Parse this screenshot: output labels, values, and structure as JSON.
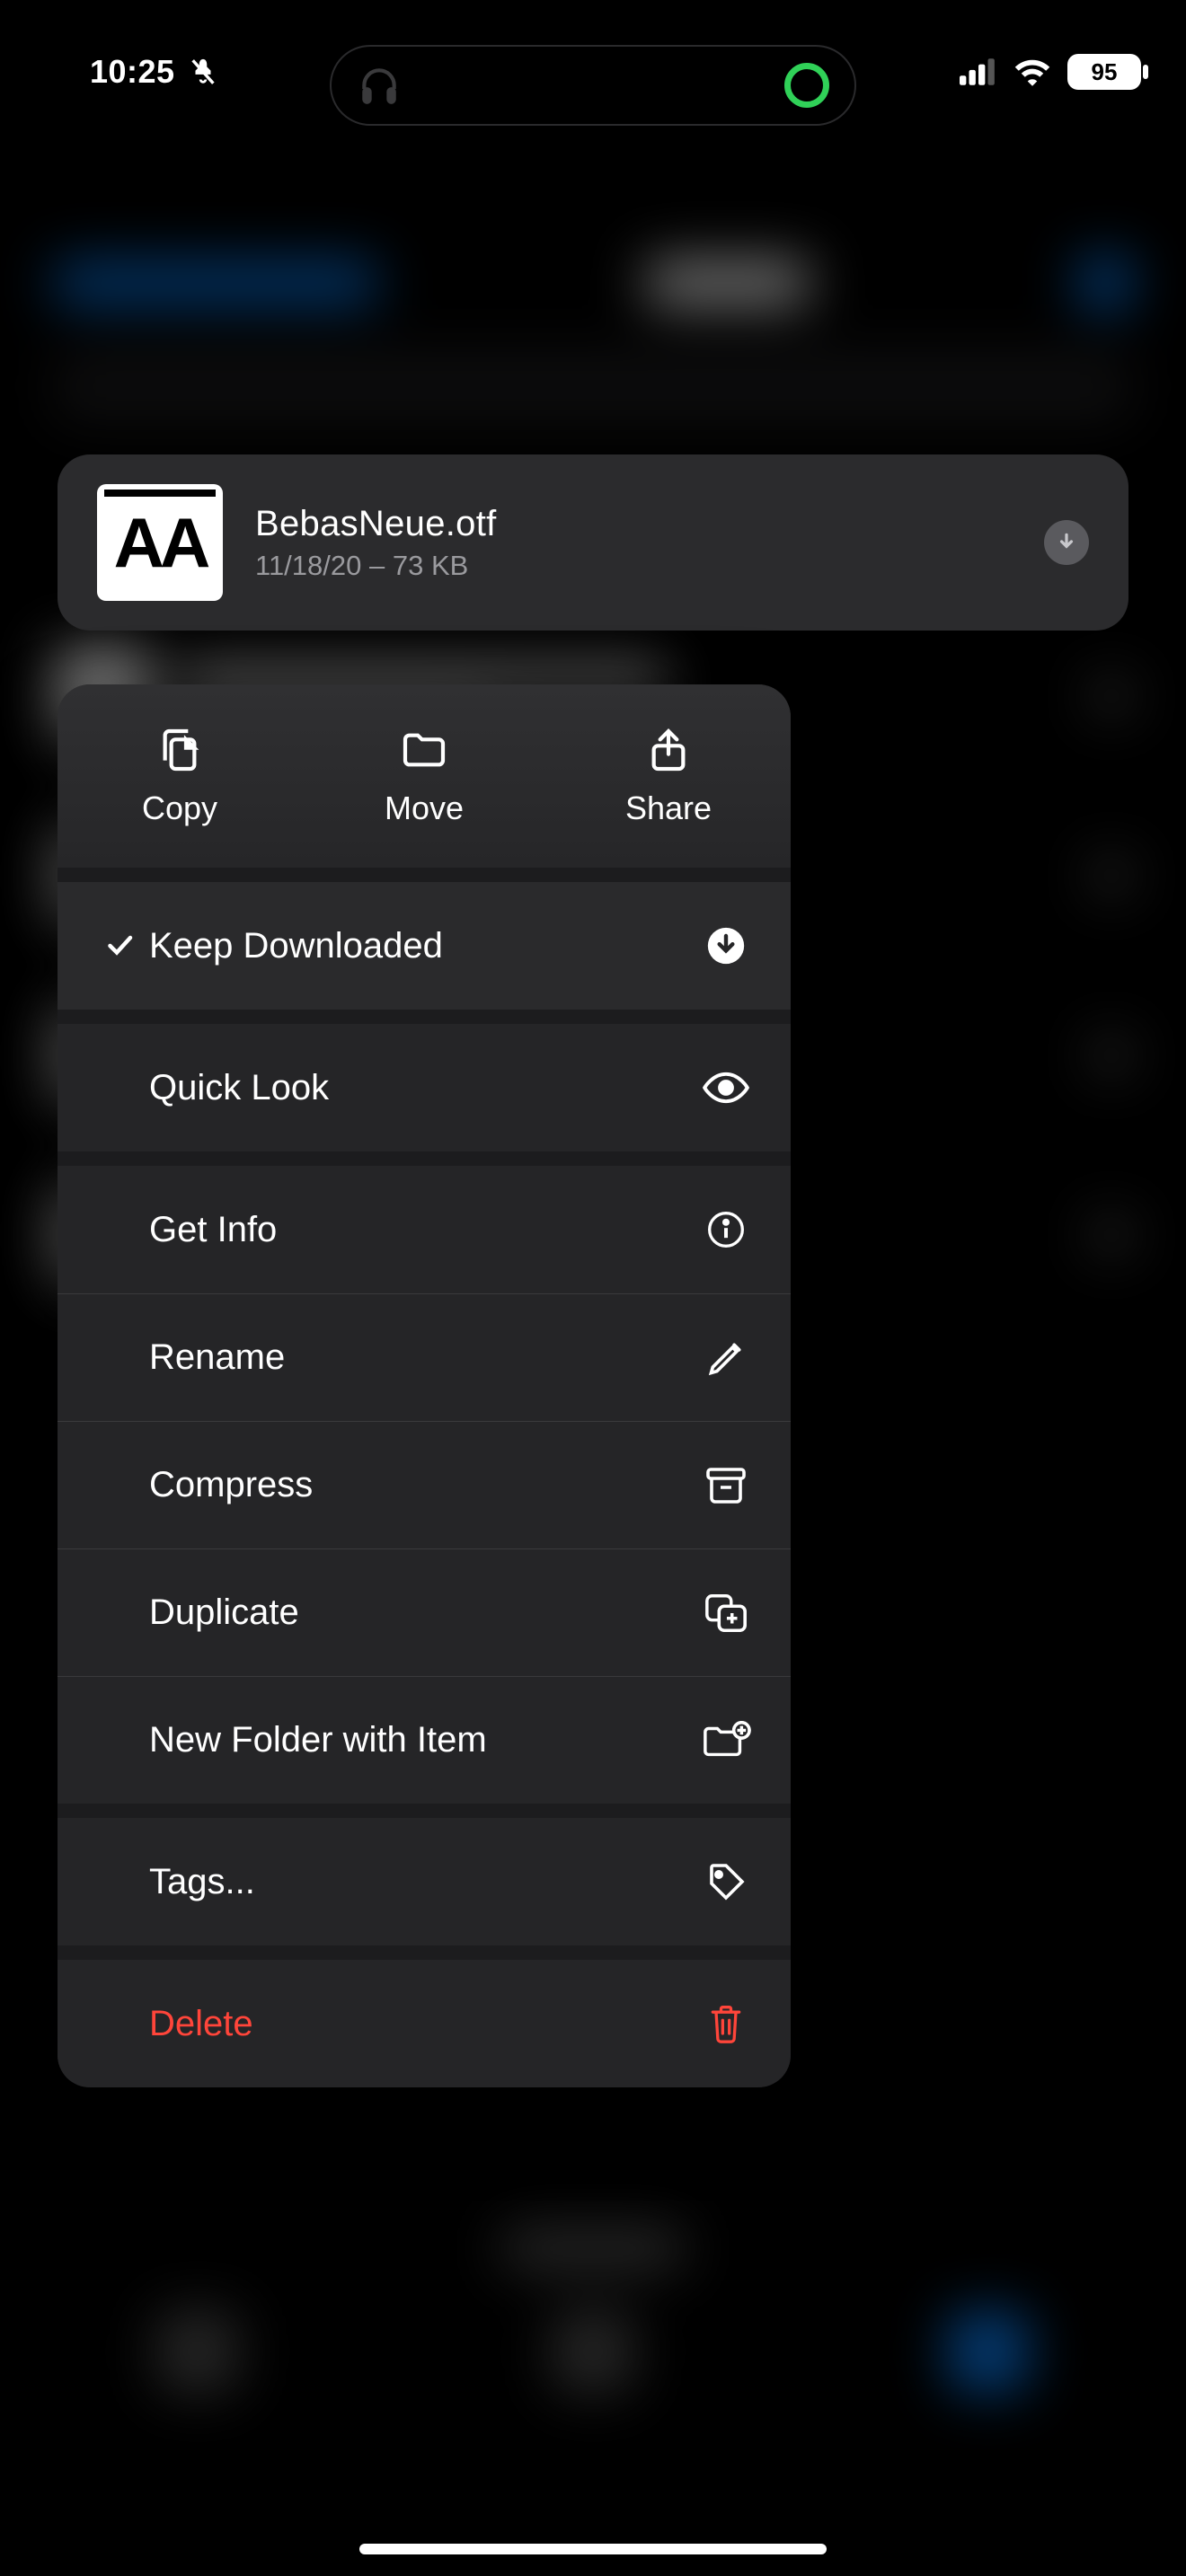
{
  "status": {
    "time": "10:25",
    "battery": "95"
  },
  "file": {
    "thumb_text": "AA",
    "name": "BebasNeue.otf",
    "date": "11/18/20",
    "size": "73 KB"
  },
  "menu": {
    "top": {
      "copy": "Copy",
      "move": "Move",
      "share": "Share"
    },
    "keep_downloaded": "Keep Downloaded",
    "quick_look": "Quick Look",
    "get_info": "Get Info",
    "rename": "Rename",
    "compress": "Compress",
    "duplicate": "Duplicate",
    "new_folder": "New Folder with Item",
    "tags": "Tags...",
    "delete": "Delete"
  }
}
